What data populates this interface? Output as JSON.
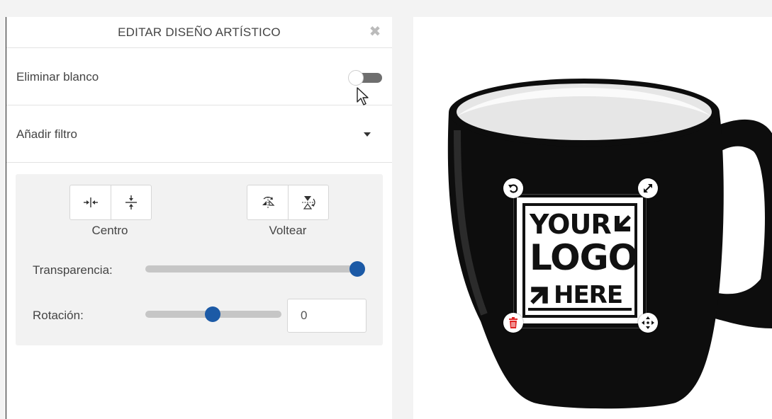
{
  "panel": {
    "title": "EDITAR DISEÑO ARTÍSTICO",
    "close_glyph": "✖",
    "remove_white": {
      "label": "Eliminar blanco",
      "enabled": false
    },
    "filter": {
      "label": "Añadir filtro"
    },
    "center": {
      "label": "Centro",
      "buttons": [
        "center-horizontal-icon",
        "center-vertical-icon"
      ]
    },
    "flip": {
      "label": "Voltear",
      "buttons": [
        "flip-horizontal-icon",
        "flip-vertical-icon"
      ]
    },
    "transparency": {
      "label": "Transparencia:",
      "value_percent": 100
    },
    "rotation": {
      "label": "Rotación:",
      "value": "0",
      "slider_percent": 50
    }
  },
  "canvas": {
    "logo": {
      "line1": "YOUR",
      "line2": "LOGO",
      "line3": "HERE"
    },
    "handles": [
      "rotate-icon",
      "resize-icon",
      "delete-icon",
      "move-icon"
    ],
    "colors": {
      "mug": "#0d0d0d",
      "mug_interior": "#f0f0f0",
      "delete": "#e02222",
      "slider_thumb": "#1c5aa6"
    }
  }
}
